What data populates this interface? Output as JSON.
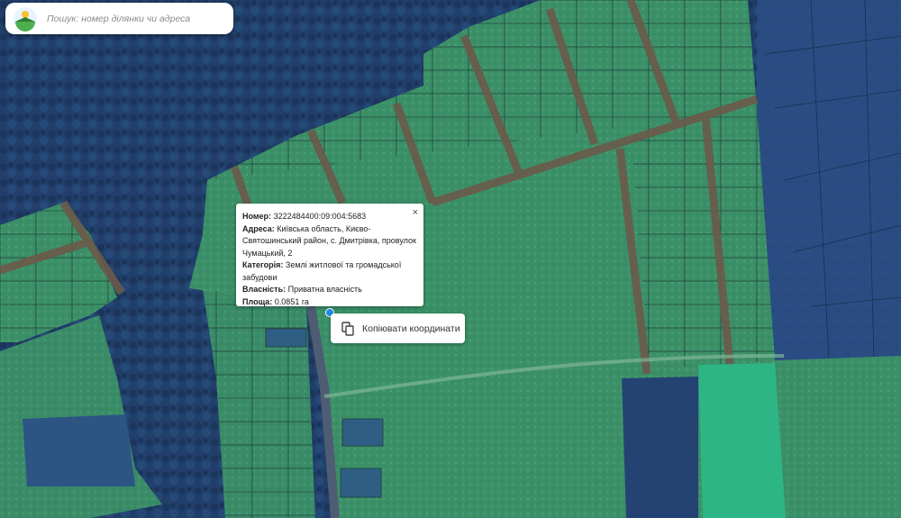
{
  "search": {
    "placeholder": "Пошук: номер ділянки чи адреса"
  },
  "popup": {
    "number_label": "Номер:",
    "number_value": "3222484400:09:004:5683",
    "address_label": "Адреса:",
    "address_value": "Київська область, Києво-Святошинський район, с. Дмитрівка, провулок Чумацький, 2",
    "category_label": "Категорія:",
    "category_value": "Землі житлової та громадської забудови",
    "ownership_label": "Власність:",
    "ownership_value": "Приватна власність",
    "area_label": "Площа:",
    "area_value": "0.0851 га",
    "close_icon": "×"
  },
  "copy_button": {
    "label": "Копіювати координати",
    "icon": "copy-icon"
  },
  "colors": {
    "forest": "#1f3f6b",
    "parcel_fill": "#3f9a6a",
    "parcel_highlight": "#2db585",
    "road": "#6b5a4a",
    "marker": "#1e88e5"
  }
}
